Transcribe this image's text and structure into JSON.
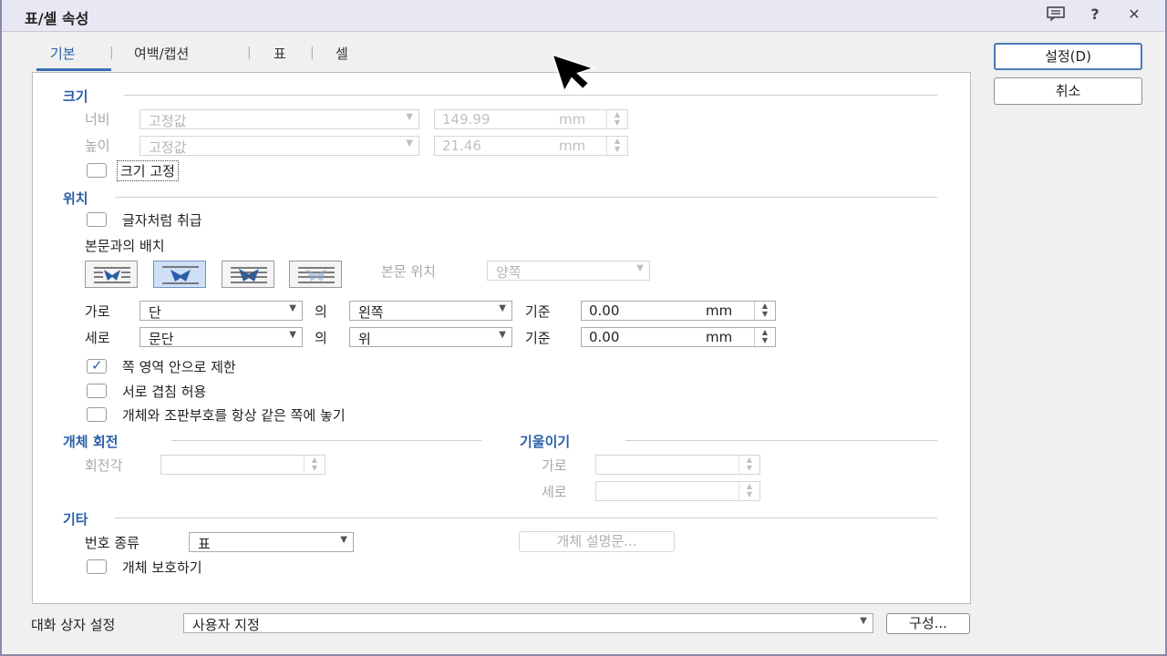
{
  "window": {
    "title": "표/셀 속성",
    "icons": [
      "comment-icon",
      "help-icon",
      "close-icon"
    ],
    "help_glyph": "?",
    "close_glyph": "✕"
  },
  "tabs": [
    {
      "label": "기본",
      "active": true
    },
    {
      "label": "여백/캡션",
      "active": false
    },
    {
      "label": "표",
      "active": false
    },
    {
      "label": "셀",
      "active": false
    }
  ],
  "tab_separator": "|",
  "size": {
    "title": "크기",
    "width_label": "너비",
    "width_mode": "고정값",
    "width_value": "149.99",
    "height_label": "높이",
    "height_mode": "고정값",
    "height_value": "21.46",
    "unit": "mm",
    "fix_size_label": "크기 고정"
  },
  "position": {
    "title": "위치",
    "treat_as_char_label": "글자처럼 취급",
    "wrap_label": "본문과의 배치",
    "text_pos_label": "본문 위치",
    "text_pos_value": "양쪽",
    "horizontal_label": "가로",
    "horizontal_value": "단",
    "horizontal_of": "의",
    "horizontal_ref": "왼쪽",
    "horizontal_base": "기준",
    "horizontal_offset": "0.00",
    "vertical_label": "세로",
    "vertical_value": "문단",
    "vertical_of": "의",
    "vertical_ref": "위",
    "vertical_base": "기준",
    "vertical_offset": "0.00",
    "unit": "mm",
    "limit_page_label": "쪽 영역 안으로 제한",
    "limit_page_checked": true,
    "allow_overlap_label": "서로 겹침 허용",
    "same_page_label": "개체와 조판부호를 항상 같은 쪽에 놓기"
  },
  "rotation": {
    "title": "개체 회전",
    "angle_label": "회전각"
  },
  "skew": {
    "title": "기울이기",
    "horizontal_label": "가로",
    "vertical_label": "세로"
  },
  "misc": {
    "title": "기타",
    "numbering_label": "번호 종류",
    "numbering_value": "표",
    "description_button": "개체 설명문...",
    "protect_label": "개체 보호하기"
  },
  "footer": {
    "dialog_setting_label": "대화 상자 설정",
    "dialog_setting_value": "사용자 지정",
    "config_button": "구성..."
  },
  "buttons": {
    "ok": "설정(D)",
    "cancel": "취소"
  },
  "colors": {
    "accent": "#2a5fa8",
    "selected_wrap": "#cfe0f6"
  }
}
